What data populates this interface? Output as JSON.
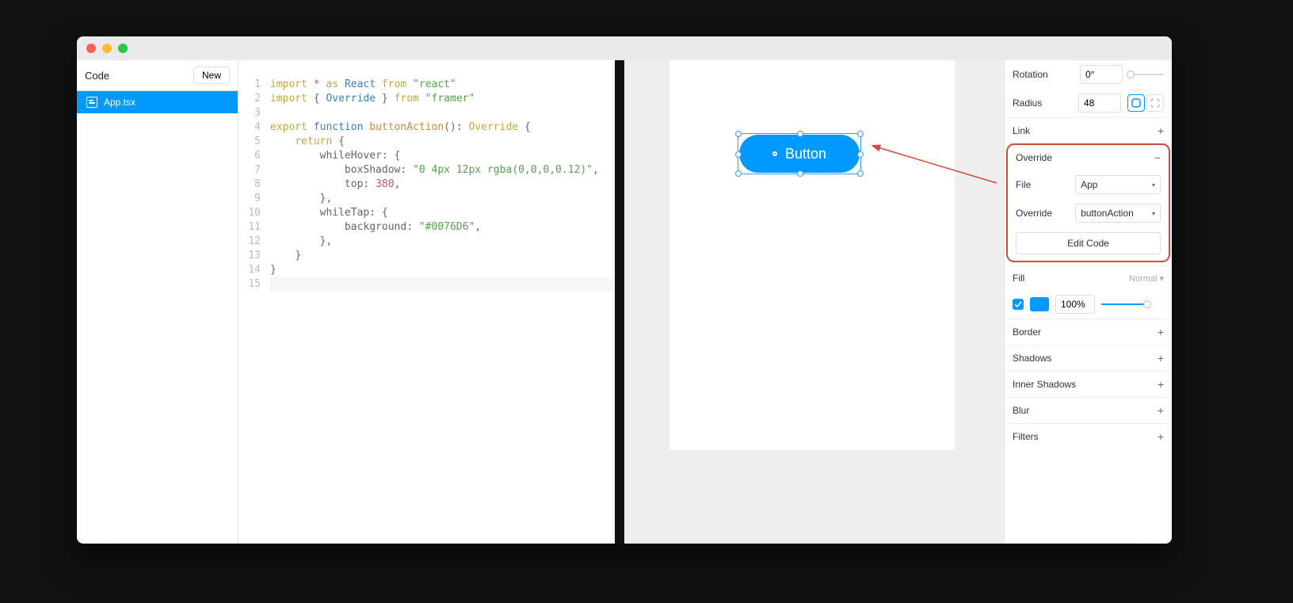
{
  "sidebar": {
    "title": "Code",
    "new_button": "New",
    "file": "App.tsx"
  },
  "code": {
    "lines": [
      "1",
      "2",
      "3",
      "4",
      "5",
      "6",
      "7",
      "8",
      "9",
      "10",
      "11",
      "12",
      "13",
      "14",
      "15"
    ],
    "l1": {
      "import": "import",
      "star": "*",
      "as": "as",
      "react": "React",
      "from": "from",
      "str": "\"react\""
    },
    "l2": {
      "import": "import",
      "brace_open": "{",
      "name": "Override",
      "brace_close": "}",
      "from": "from",
      "str": "\"framer\""
    },
    "l4": {
      "export": "export",
      "function": "function",
      "fnname": "buttonAction",
      "paren": "():",
      "type": "Override",
      "brace": "{"
    },
    "l5": {
      "return": "return",
      "brace": "{"
    },
    "l6": {
      "prop": "whileHover:",
      "brace": "{"
    },
    "l7": {
      "prop": "boxShadow:",
      "str": "\"0 4px 12px rgba(0,0,0,0.12)\"",
      "comma": ","
    },
    "l8": {
      "prop": "top:",
      "num": "380",
      "comma": ","
    },
    "l9": {
      "brace": "},"
    },
    "l10": {
      "prop": "whileTap:",
      "brace": "{"
    },
    "l11": {
      "prop": "background:",
      "str": "\"#0076D6\"",
      "comma": ","
    },
    "l12": {
      "brace": "},"
    },
    "l13": {
      "brace": "}"
    },
    "l14": {
      "brace": "}"
    }
  },
  "canvas": {
    "button_label": "Button"
  },
  "inspector": {
    "rotation_label": "Rotation",
    "rotation_value": "0°",
    "radius_label": "Radius",
    "radius_value": "48",
    "link_label": "Link",
    "override_label": "Override",
    "file_label": "File",
    "file_value": "App",
    "override_field_label": "Override",
    "override_value": "buttonAction",
    "edit_code": "Edit Code",
    "fill_label": "Fill",
    "fill_mode": "Normal",
    "fill_pct": "100%",
    "border_label": "Border",
    "shadows_label": "Shadows",
    "inner_shadows_label": "Inner Shadows",
    "blur_label": "Blur",
    "filters_label": "Filters"
  }
}
